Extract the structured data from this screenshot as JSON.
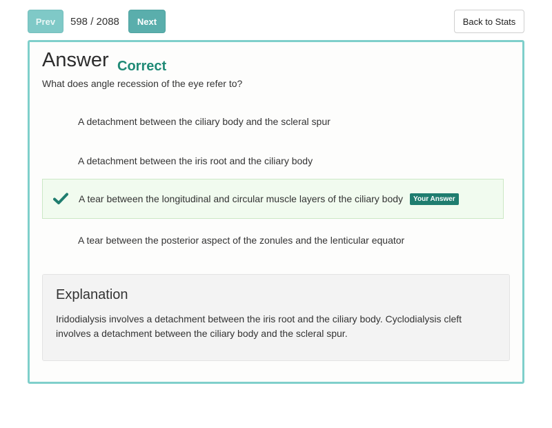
{
  "nav": {
    "prev_label": "Prev",
    "counter": "598 / 2088",
    "next_label": "Next",
    "back_label": "Back to Stats"
  },
  "answer": {
    "heading": "Answer",
    "result": "Correct",
    "question": "What does angle recession of the eye refer to?",
    "options": [
      {
        "text": "A detachment between the ciliary body and the scleral spur",
        "selected": false
      },
      {
        "text": "A detachment between the iris root and the ciliary body",
        "selected": false
      },
      {
        "text": "A tear between the longitudinal and circular muscle layers of the ciliary body",
        "selected": true,
        "badge": "Your Answer",
        "icon": "check-icon"
      },
      {
        "text": "A tear between the posterior aspect of the zonules and the lenticular equator",
        "selected": false
      }
    ]
  },
  "explanation": {
    "heading": "Explanation",
    "body": "Iridodialysis involves a detachment between the iris root and the ciliary body. Cyclodialysis cleft involves a detachment between the ciliary body and the scleral spur."
  },
  "colors": {
    "accent": "#5aaeac",
    "correct": "#1f8a76",
    "card_border": "#7fcfcb",
    "selected_bg": "#f1fbef"
  }
}
